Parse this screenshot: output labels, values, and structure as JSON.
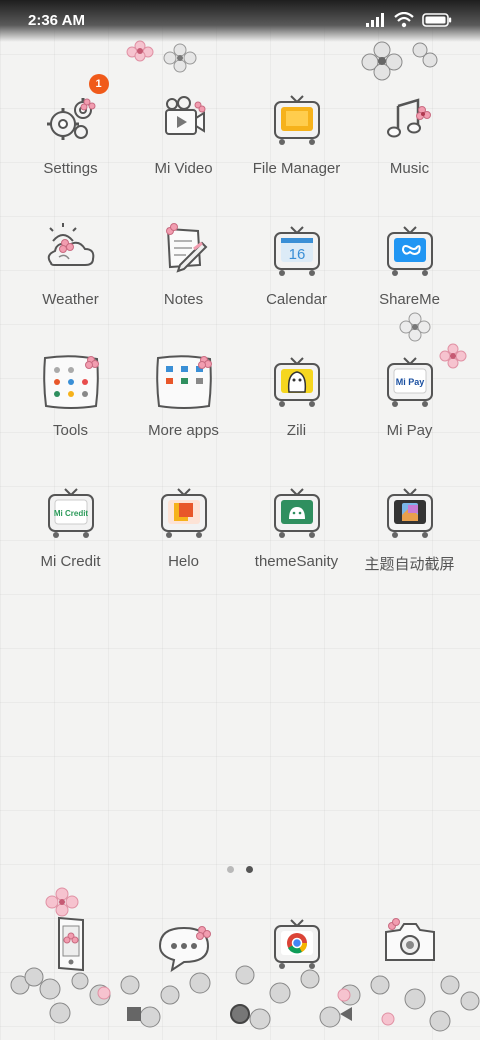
{
  "status": {
    "time": "2:36 AM"
  },
  "apps": [
    [
      {
        "label": "Settings",
        "icon": "gear-icon",
        "badge": "1"
      },
      {
        "label": "Mi Video",
        "icon": "video-icon"
      },
      {
        "label": "File Manager",
        "icon": "folder-tv-icon"
      },
      {
        "label": "Music",
        "icon": "music-note-icon"
      }
    ],
    [
      {
        "label": "Weather",
        "icon": "cloud-sun-icon"
      },
      {
        "label": "Notes",
        "icon": "notepad-icon"
      },
      {
        "label": "Calendar",
        "icon": "calendar-tv-icon",
        "number": "16"
      },
      {
        "label": "ShareMe",
        "icon": "shareme-tv-icon"
      }
    ],
    [
      {
        "label": "Tools",
        "icon": "tools-folder-icon"
      },
      {
        "label": "More apps",
        "icon": "more-apps-folder-icon"
      },
      {
        "label": "Zili",
        "icon": "zili-tv-icon"
      },
      {
        "label": "Mi Pay",
        "icon": "mipay-tv-icon",
        "screen_text": "Mi Pay"
      }
    ],
    [
      {
        "label": "Mi Credit",
        "icon": "micredit-tv-icon",
        "screen_text": "Mi Credit"
      },
      {
        "label": "Helo",
        "icon": "helo-tv-icon"
      },
      {
        "label": "themeSanity",
        "icon": "android-tv-icon"
      },
      {
        "label": "主题自动截屏",
        "icon": "screenshot-tv-icon"
      }
    ]
  ],
  "dock": [
    {
      "icon": "phone-icon"
    },
    {
      "icon": "message-bubble-icon"
    },
    {
      "icon": "chrome-tv-icon"
    },
    {
      "icon": "camera-icon"
    }
  ],
  "page_indicator": {
    "pages": 2,
    "active": 2
  },
  "colors": {
    "badge": "#f05a1a",
    "folder": "#f6b21b",
    "calendar": "#3a8fd6",
    "shareme": "#2196f3",
    "zili": "#f5d61f",
    "helo": "#e8572a",
    "android": "#2f8f5f",
    "flower": "#f2a2b5"
  }
}
